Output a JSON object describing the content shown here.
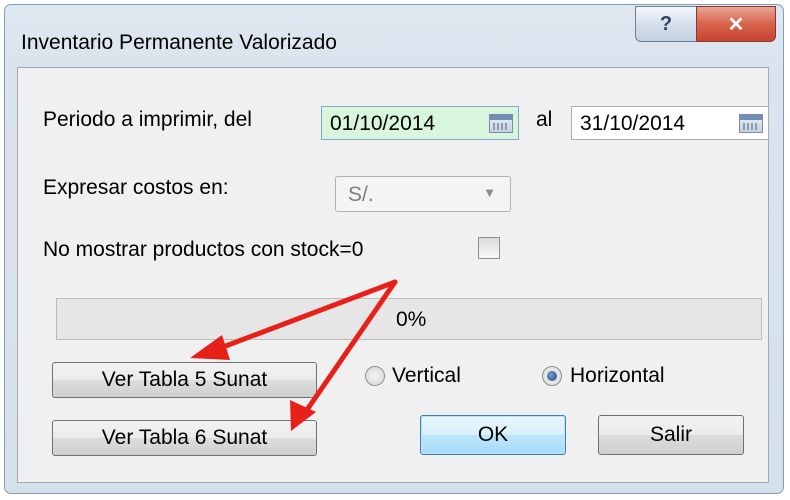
{
  "window": {
    "title": "Inventario Permanente Valorizado",
    "help_label": "?",
    "close_label": "✕"
  },
  "period": {
    "label": "Periodo a imprimir, del",
    "from": "01/10/2014",
    "to_label": "al",
    "to": "31/10/2014"
  },
  "currency": {
    "label": "Expresar costos en:",
    "value": "S/."
  },
  "stock_zero": {
    "label": "No mostrar productos con stock=0",
    "checked": false
  },
  "progress": {
    "text": "0%",
    "value": 0
  },
  "buttons": {
    "tabla5": "Ver Tabla 5 Sunat",
    "tabla6": "Ver Tabla 6 Sunat",
    "ok": "OK",
    "exit": "Salir"
  },
  "orientation": {
    "vertical": "Vertical",
    "horizontal": "Horizontal",
    "selected": "Horizontal"
  },
  "annotation": {
    "arrow_color": "#e8201a"
  },
  "icons": {
    "help": "help-icon",
    "close": "close-icon",
    "calendar": "calendar-icon",
    "dropdown": "chevron-down-icon"
  }
}
